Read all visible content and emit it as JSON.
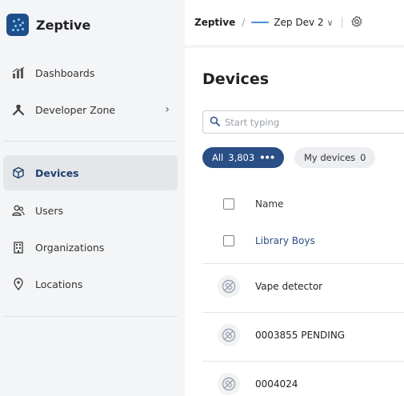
{
  "brand": {
    "name": "Zeptive"
  },
  "sidebar": {
    "items": [
      {
        "label": "Dashboards",
        "icon": "bar-chart-icon"
      },
      {
        "label": "Developer Zone",
        "icon": "tools-icon"
      },
      {
        "label": "Devices",
        "icon": "cube-icon",
        "active": true
      },
      {
        "label": "Users",
        "icon": "users-icon"
      },
      {
        "label": "Organizations",
        "icon": "building-icon"
      },
      {
        "label": "Locations",
        "icon": "location-pin-icon"
      }
    ]
  },
  "topbar": {
    "org": "Zeptive",
    "separator": "/",
    "project": "Zep Dev 2"
  },
  "main": {
    "title": "Devices",
    "search": {
      "placeholder": "Start typing",
      "value": ""
    },
    "filters": {
      "all": {
        "label": "All",
        "count": "3,803",
        "more": "•••"
      },
      "mine": {
        "label": "My devices",
        "count": "0"
      }
    },
    "table": {
      "column_name": "Name",
      "rows": [
        {
          "name": "Library Boys",
          "kind": "group"
        },
        {
          "name": "Vape detector",
          "kind": "device"
        },
        {
          "name": "0003855 PENDING",
          "kind": "device"
        },
        {
          "name": "0004024",
          "kind": "device"
        }
      ]
    }
  },
  "colors": {
    "accent": "#2a4f86",
    "active_nav_bg": "#e4e6ea",
    "brand_logo": "#1f4f8a"
  }
}
